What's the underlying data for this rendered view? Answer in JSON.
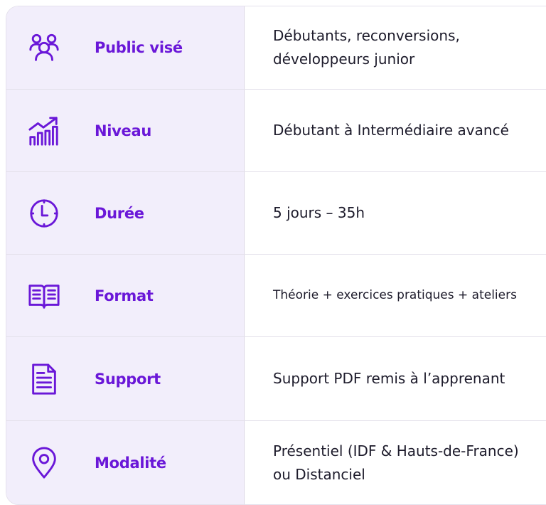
{
  "colors": {
    "accent": "#6a17d8",
    "label_bg": "#f2eefb",
    "text": "#1d1b2b",
    "border": "#e3e0ea"
  },
  "rows": [
    {
      "icon": "users-icon",
      "label": "Public visé",
      "value": "Débutants, reconversions,\ndéveloppeurs junior"
    },
    {
      "icon": "growth-chart-icon",
      "label": "Niveau",
      "value": "Débutant à Intermédiaire avancé"
    },
    {
      "icon": "clock-icon",
      "label": "Durée",
      "value": "5 jours – 35h"
    },
    {
      "icon": "book-icon",
      "label": "Format",
      "value": "Théorie + exercices pratiques + ateliers"
    },
    {
      "icon": "document-icon",
      "label": "Support",
      "value": "Support PDF remis à l’apprenant"
    },
    {
      "icon": "location-pin-icon",
      "label": "Modalité",
      "value": "Présentiel (IDF & Hauts-de-France)\nou Distanciel"
    }
  ]
}
